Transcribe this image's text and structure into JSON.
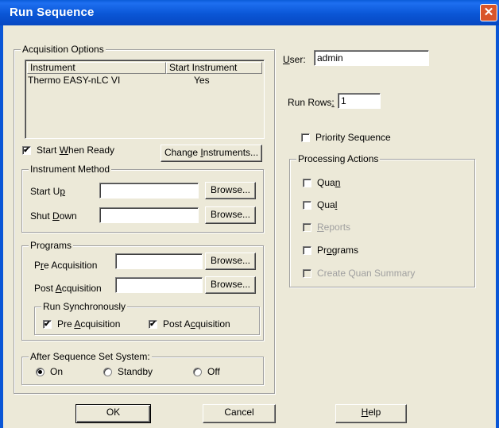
{
  "window": {
    "title": "Run Sequence",
    "close_glyph": "✕",
    "titlebar_color": "#0a56d6",
    "face_color": "#ece9d8"
  },
  "acquisition": {
    "legend": "Acquisition Options",
    "columns": [
      "Instrument",
      "Start Instrument"
    ],
    "rows": [
      {
        "instrument": "Thermo EASY-nLC VI",
        "start": "Yes"
      }
    ],
    "start_when_ready": {
      "pre": "Start ",
      "key": "W",
      "post": "hen Ready",
      "checked": true
    },
    "change_instruments": {
      "pre": "Change ",
      "key": "I",
      "post": "nstruments..."
    }
  },
  "instrument_method": {
    "legend": "Instrument Method",
    "start_up": {
      "pre": "Start U",
      "key": "p",
      "post": "",
      "value": ""
    },
    "shut_down": {
      "pre": "Shut ",
      "key": "D",
      "post": "own",
      "value": ""
    },
    "browse": "Browse..."
  },
  "programs": {
    "legend": "Programs",
    "pre_acquisition": {
      "pre": "P",
      "key": "r",
      "post": "e Acquisition",
      "value": ""
    },
    "post_acquisition": {
      "pre": "Post ",
      "key": "A",
      "post": "cquisition",
      "value": ""
    },
    "browse": "Browse...",
    "run_sync": {
      "legend": "Run Synchronously",
      "pre": {
        "pre": "Pre ",
        "key": "A",
        "post": "cquisition",
        "checked": true
      },
      "post": {
        "pre": "Post A",
        "key": "c",
        "post": "quisition",
        "checked": true
      }
    }
  },
  "after_sequence": {
    "legend": "After Sequence Set System:",
    "options": [
      "On",
      "Standby",
      "Off"
    ],
    "selected": "On"
  },
  "user": {
    "key": "U",
    "post": "ser:",
    "value": "admin"
  },
  "run_rows": {
    "pre": "Run Rows",
    "key": ":",
    "value": "1"
  },
  "priority": {
    "label": "Priority Sequence",
    "checked": false
  },
  "processing": {
    "legend": "Processing Actions",
    "quan": {
      "pre": "Qua",
      "key": "n",
      "post": "",
      "checked": false,
      "enabled": true
    },
    "qual": {
      "pre": "Qua",
      "key": "l",
      "post": "",
      "checked": false,
      "enabled": true
    },
    "reports": {
      "pre": "",
      "key": "R",
      "post": "eports",
      "checked": false,
      "enabled": false
    },
    "programs": {
      "pre": "Pr",
      "key": "o",
      "post": "grams",
      "checked": false,
      "enabled": true
    },
    "create_quan_summary": {
      "pre": "",
      "key": "",
      "post": "Create Quan Summary",
      "checked": false,
      "enabled": false
    }
  },
  "footer": {
    "ok": "OK",
    "cancel": "Cancel",
    "help": {
      "key": "H",
      "post": "elp"
    }
  },
  "check_glyph": "✔"
}
